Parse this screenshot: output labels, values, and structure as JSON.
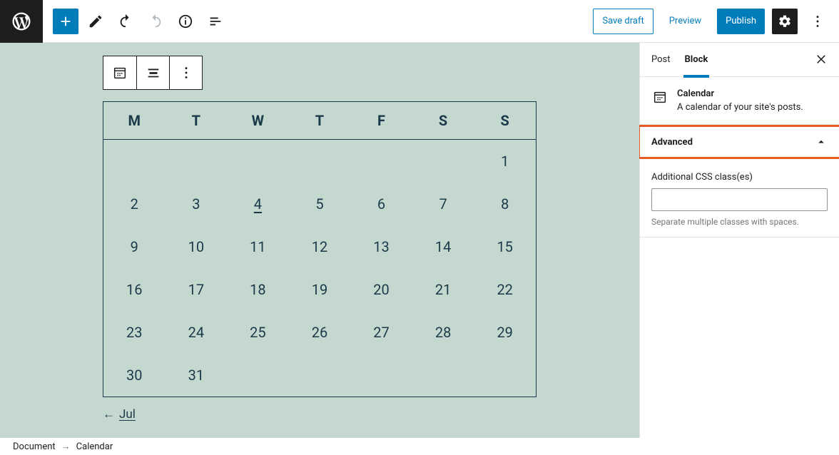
{
  "toolbar": {
    "save_draft": "Save draft",
    "preview": "Preview",
    "publish": "Publish"
  },
  "sidebar": {
    "tabs": {
      "post": "Post",
      "block": "Block"
    },
    "block_title": "Calendar",
    "block_desc": "A calendar of your site's posts.",
    "advanced_label": "Advanced",
    "css_label": "Additional CSS class(es)",
    "css_value": "",
    "css_help": "Separate multiple classes with spaces."
  },
  "calendar": {
    "headers": [
      "M",
      "T",
      "W",
      "T",
      "F",
      "S",
      "S"
    ],
    "weeks": [
      [
        "",
        "",
        "",
        "",
        "",
        "",
        "1"
      ],
      [
        "2",
        "3",
        "4",
        "5",
        "6",
        "7",
        "8"
      ],
      [
        "9",
        "10",
        "11",
        "12",
        "13",
        "14",
        "15"
      ],
      [
        "16",
        "17",
        "18",
        "19",
        "20",
        "21",
        "22"
      ],
      [
        "23",
        "24",
        "25",
        "26",
        "27",
        "28",
        "29"
      ],
      [
        "30",
        "31",
        "",
        "",
        "",
        "",
        ""
      ]
    ],
    "today": "4",
    "prev_label": "Jul",
    "prev_arrow": "←"
  },
  "breadcrumb": {
    "root": "Document",
    "sep": "→",
    "current": "Calendar"
  }
}
